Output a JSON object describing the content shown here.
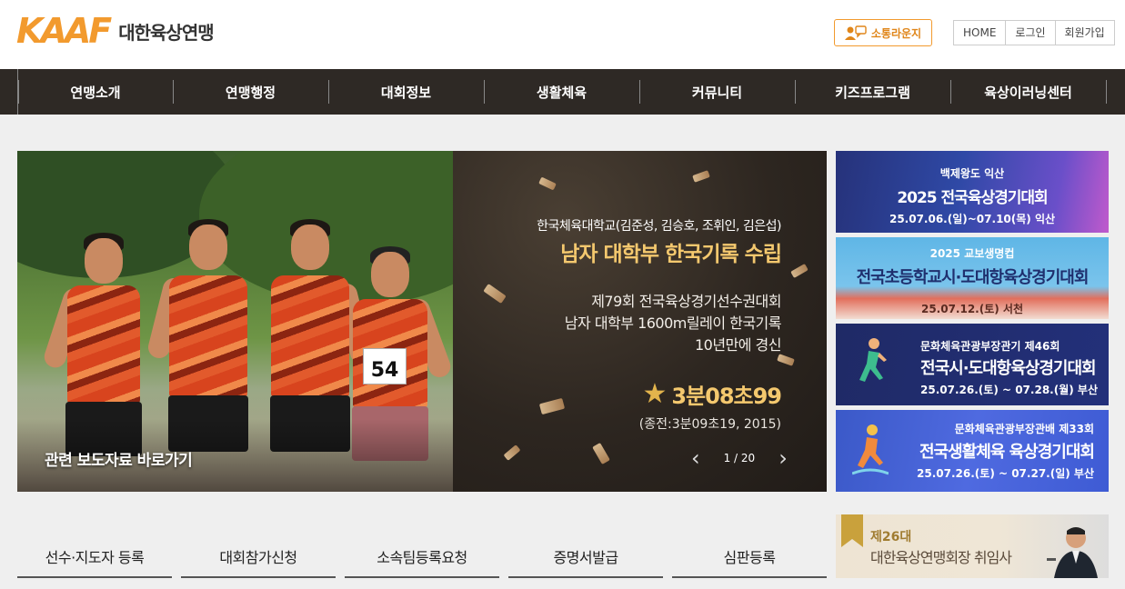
{
  "header": {
    "logo_mark": "KAAF",
    "logo_text": "대한육상연맹",
    "lounge_label": "소통라운지",
    "util": [
      "HOME",
      "로그인",
      "회원가입"
    ]
  },
  "nav": {
    "items": [
      "연맹소개",
      "연맹행정",
      "대회정보",
      "생활체육",
      "커뮤니티",
      "키즈프로그램",
      "육상이러닝센터"
    ]
  },
  "hero": {
    "photo_caption": "관련 보도자료 바로가기",
    "bib_number": "54",
    "subtitle": "한국체육대학교(김준성, 김승호, 조휘인, 김은섭)",
    "title": "남자 대학부 한국기록 수립",
    "lines": [
      "제79회 전국육상경기선수권대회",
      "남자 대학부 1600m릴레이 한국기록",
      "10년만에 경신"
    ],
    "record": "3분08초99",
    "previous": "(종전:3분09초19, 2015)",
    "pager": "1 / 20"
  },
  "banners": [
    {
      "l1": "백제왕도 익산",
      "l2": "2025 전국육상경기대회",
      "l3": "25.07.06.(일)~07.10(목) 익산"
    },
    {
      "l1": "2025 교보생명컵",
      "l2": "전국초등학교시·도대항육상경기대회",
      "l3": "25.07.12.(토) 서천"
    },
    {
      "l1": "문화체육관광부장관기 제46회",
      "l2": "전국시·도대항육상경기대회",
      "l3": "25.07.26.(토) ~ 07.28.(월) 부산"
    },
    {
      "l1": "문화체육관광부장관배 제33회",
      "l2": "전국생활체육 육상경기대회",
      "l3": "25.07.26.(토) ~ 07.27.(일) 부산"
    }
  ],
  "quick_links": [
    "선수·지도자 등록",
    "대회참가신청",
    "소속팀등록요청",
    "증명서발급",
    "심판등록"
  ],
  "president_banner": {
    "t1": "제26대",
    "t2": "대한육상연맹회장 취임사"
  },
  "colors": {
    "accent": "#f29a2e",
    "nav_bg": "#2e2925",
    "gold_text": "#f4c86e"
  }
}
